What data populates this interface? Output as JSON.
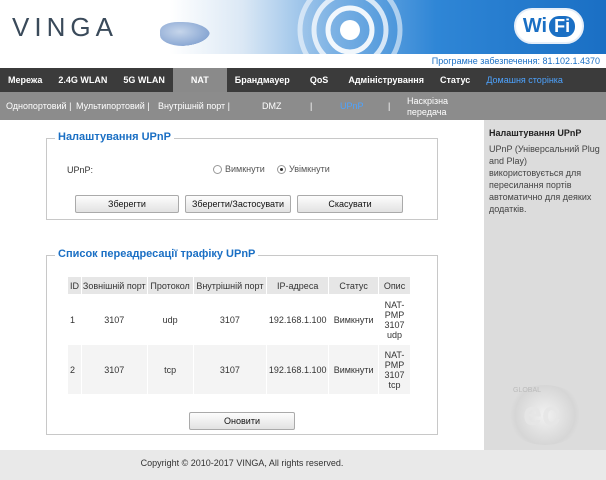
{
  "brand": {
    "logo": "VINGA",
    "wifi_left": "Wi",
    "wifi_right": "Fi"
  },
  "firmware": "Програмне забезпечення: 81.102.1.4370",
  "main_nav": [
    {
      "label": "Мережа"
    },
    {
      "label": "2.4G WLAN"
    },
    {
      "label": "5G WLAN"
    },
    {
      "label": "NAT"
    },
    {
      "label": "Брандмауер"
    },
    {
      "label": "QoS"
    },
    {
      "label": "Адміністрування"
    },
    {
      "label": "Статус"
    },
    {
      "label": "Домашня сторінка"
    }
  ],
  "sub_nav": [
    {
      "label": "Однопортовий  |"
    },
    {
      "label": "Мультипортовий |"
    },
    {
      "label": "Внутрішній порт  |"
    },
    {
      "label": "DMZ"
    },
    {
      "label": "|"
    },
    {
      "label": "UPnP"
    },
    {
      "label": "|"
    },
    {
      "label": "Наскрізна"
    },
    {
      "label": "передача"
    }
  ],
  "settings": {
    "title": "Налаштування UPnP",
    "upnp_label": "UPnP:",
    "radio_off": "Вимкнути",
    "radio_on": "Увімкнути",
    "selected": "on",
    "save": "Зберегти",
    "save_apply": "Зберегти/Застосувати",
    "cancel": "Скасувати"
  },
  "forwarding": {
    "title": "Список переадресації трафіку UPnP",
    "columns": [
      "ID",
      "Зовнішній порт",
      "Протокол",
      "Внутрішній порт",
      "IP-адреса",
      "Статус",
      "Опис"
    ],
    "rows": [
      {
        "id": "1",
        "ext": "3107",
        "proto": "udp",
        "int": "3107",
        "ip": "192.168.1.100",
        "status": "Вимкнути",
        "desc": [
          "NAT-",
          "PMP",
          "3107",
          "udp"
        ]
      },
      {
        "id": "2",
        "ext": "3107",
        "proto": "tcp",
        "int": "3107",
        "ip": "192.168.1.100",
        "status": "Вимкнути",
        "desc": [
          "NAT-",
          "PMP",
          "3107",
          "tcp"
        ]
      }
    ],
    "refresh": "Оновити"
  },
  "help": {
    "title": "Налаштування UPnP",
    "text": "UPnP (Універсальний Plug and Play) використовується для пересилання портів автоматично для деяких додатків."
  },
  "footer": "Copyright © 2010-2017 VINGA, All rights reserved.",
  "watermark": {
    "letters": "ec",
    "text": "GLOBAL"
  }
}
